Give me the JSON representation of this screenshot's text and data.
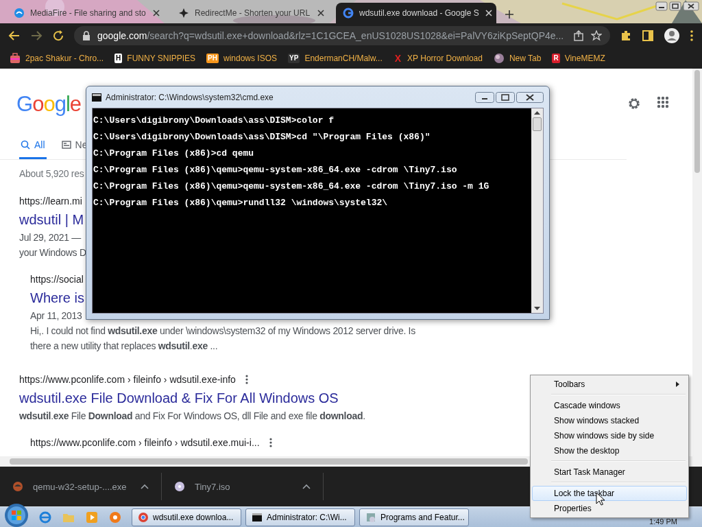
{
  "browser": {
    "tabs": [
      {
        "title": "MediaFire - File sharing and sto",
        "selected": false
      },
      {
        "title": "RedirectMe - Shorten your URL",
        "selected": false
      },
      {
        "title": "wdsutil.exe download - Google S",
        "selected": true
      }
    ],
    "address": {
      "domain": "google.com",
      "path": "/search?q=wdsutil.exe+download&rlz=1C1GCEA_enUS1028US1028&ei=PalVY6ziKpSeptQP4e..."
    },
    "bookmarks": [
      {
        "label": "2pac Shakur - Chro...",
        "kind": "picture"
      },
      {
        "label": "FUNNY SNIPPIES",
        "kind": "letter",
        "badge": "H",
        "color": "#ffffff"
      },
      {
        "label": "windows ISOS",
        "kind": "letter",
        "badge": "PH",
        "color": "#f7971d"
      },
      {
        "label": "EndermanCH/Malw...",
        "kind": "letter",
        "badge": "YP",
        "color": "#333333"
      },
      {
        "label": "XP Horror Download",
        "kind": "glyph",
        "badge": "X",
        "color": "#e02020"
      },
      {
        "label": "New Tab",
        "kind": "picture"
      },
      {
        "label": "VineMEMZ",
        "kind": "letter",
        "badge": "R",
        "color": "#d81e2c"
      }
    ]
  },
  "google": {
    "logo": "Google",
    "nav_tabs": [
      {
        "label": "All",
        "selected": true
      },
      {
        "label": "Ne",
        "selected": false
      }
    ],
    "result_stats": "About 5,920 res",
    "results": [
      {
        "url": "https://learn.mi",
        "title": "wdsutil | M",
        "lines": [
          "Jul 29, 2021 —",
          "your Windows D"
        ],
        "menu": false,
        "children": [
          {
            "url": "https://social",
            "title": "Where is",
            "lines": [
              "Apr 11, 2013",
              "Hi,. I could not find **wdsutil.exe** under \\windows\\system32 of my Windows 2012 server drive. Is",
              "there a new utility that replaces **wdsutil**.**exe** ..."
            ],
            "menu": false
          }
        ]
      },
      {
        "url": "https://www.pconlife.com › fileinfo › wdsutil.exe-info",
        "title": "wdsutil.exe File Download & Fix For All Windows OS",
        "lines": [
          "**wdsutil**.**exe** File **Download** and Fix For Windows OS, dll File and exe file **download**."
        ],
        "menu": true,
        "children": [
          {
            "url": "https://www.pconlife.com › fileinfo › wdsutil.exe.mui-i...",
            "menu": true
          }
        ]
      }
    ]
  },
  "cmd": {
    "title": "Administrator: C:\\Windows\\system32\\cmd.exe",
    "lines": [
      "C:\\Users\\digibrony\\Downloads\\ass\\DISM>color f",
      "C:\\Users\\digibrony\\Downloads\\ass\\DISM>cd \"\\Program Files (x86)\"",
      "C:\\Program Files (x86)>cd qemu",
      "C:\\Program Files (x86)\\qemu>qemu-system-x86_64.exe -cdrom \\Tiny7.iso",
      "C:\\Program Files (x86)\\qemu>qemu-system-x86_64.exe -cdrom \\Tiny7.iso -m 1G",
      "C:\\Program Files (x86)\\qemu>rundll32 \\windows\\systel32\\"
    ]
  },
  "downloads": [
    {
      "name": "qemu-w32-setup-....exe",
      "kind": "installer"
    },
    {
      "name": "Tiny7.iso",
      "kind": "disc"
    }
  ],
  "taskbar": {
    "tasks": [
      {
        "label": "wdsutil.exe downloa...",
        "kind": "browser"
      },
      {
        "label": "Administrator: C:\\Wi...",
        "kind": "console"
      },
      {
        "label": "Programs and Featur...",
        "kind": "programs"
      }
    ],
    "clock": "1:49 PM"
  },
  "context_menu": {
    "items": [
      {
        "kind": "item",
        "label": "Toolbars",
        "submenu": true,
        "selected": false
      },
      {
        "kind": "separator"
      },
      {
        "kind": "item",
        "label": "Cascade windows",
        "submenu": false,
        "selected": false
      },
      {
        "kind": "item",
        "label": "Show windows stacked",
        "submenu": false,
        "selected": false
      },
      {
        "kind": "item",
        "label": "Show windows side by side",
        "submenu": false,
        "selected": false
      },
      {
        "kind": "item",
        "label": "Show the desktop",
        "submenu": false,
        "selected": false
      },
      {
        "kind": "separator"
      },
      {
        "kind": "item",
        "label": "Start Task Manager",
        "submenu": false,
        "selected": false
      },
      {
        "kind": "separator"
      },
      {
        "kind": "item",
        "label": "Lock the taskbar",
        "submenu": false,
        "selected": true
      },
      {
        "kind": "item",
        "label": "Properties",
        "submenu": false,
        "selected": false
      }
    ]
  }
}
